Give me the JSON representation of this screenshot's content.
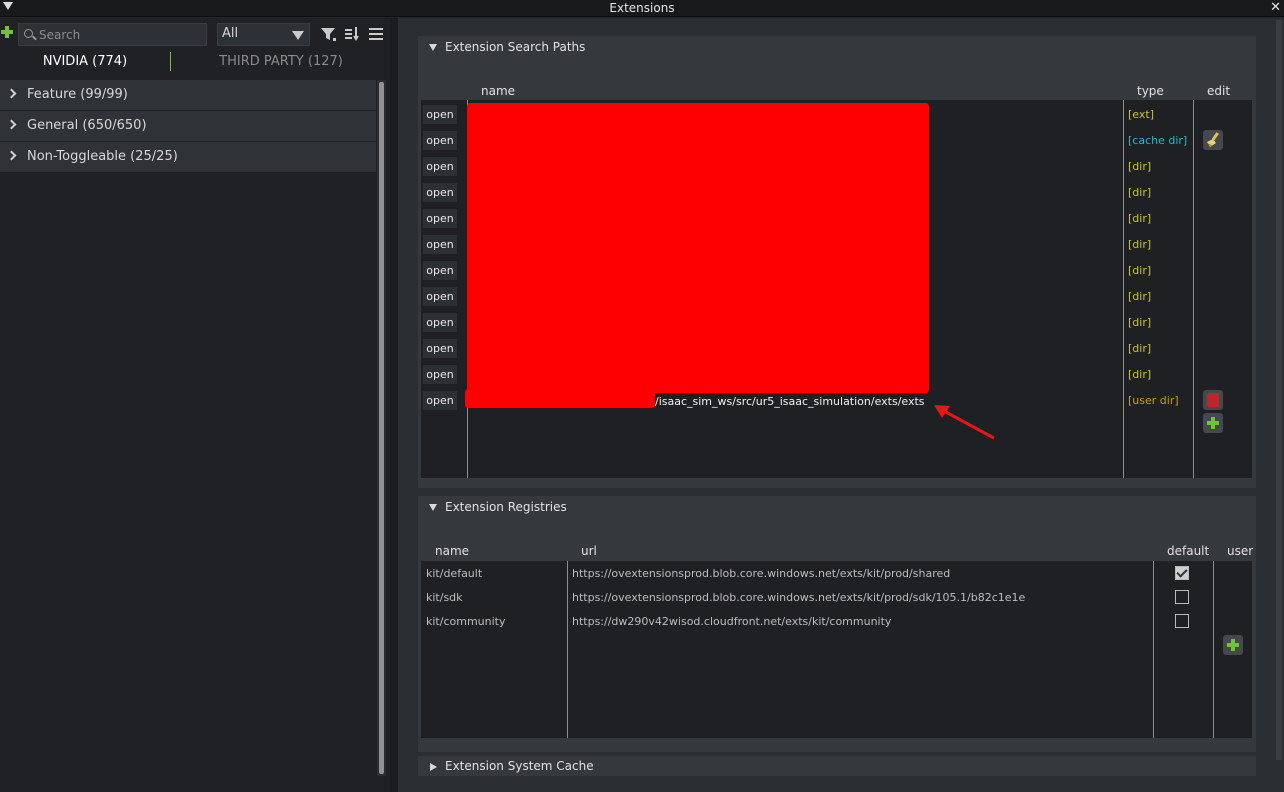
{
  "window": {
    "title": "Extensions",
    "close": "✕"
  },
  "toolbar": {
    "search_placeholder": "Search",
    "filter_value": "All"
  },
  "tabs": [
    {
      "label": "NVIDIA (774)"
    },
    {
      "label": "THIRD PARTY (127)"
    }
  ],
  "categories": [
    {
      "label": "Feature (99/99)"
    },
    {
      "label": "General (650/650)"
    },
    {
      "label": "Non-Toggleable (25/25)"
    }
  ],
  "search_paths": {
    "header": "Extension Search Paths",
    "columns": {
      "name": "name",
      "type": "type",
      "edit": "edit"
    },
    "open_label": "open",
    "rows": [
      {
        "type": "[ext]"
      },
      {
        "type": "[cache dir]"
      },
      {
        "type": "[dir]"
      },
      {
        "type": "[dir]"
      },
      {
        "type": "[dir]"
      },
      {
        "type": "[dir]"
      },
      {
        "type": "[dir]"
      },
      {
        "type": "[dir]"
      },
      {
        "type": "[dir]"
      },
      {
        "type": "[dir]"
      },
      {
        "type": "[dir]"
      },
      {
        "type": "[user dir]",
        "path_visible": "/isaac_sim_ws/src/ur5_isaac_simulation/exts/exts"
      }
    ]
  },
  "registries": {
    "header": "Extension Registries",
    "columns": {
      "name": "name",
      "url": "url",
      "default": "default",
      "user": "user"
    },
    "rows": [
      {
        "name": "kit/default",
        "url": "https://ovextensionsprod.blob.core.windows.net/exts/kit/prod/shared",
        "default": true
      },
      {
        "name": "kit/sdk",
        "url": "https://ovextensionsprod.blob.core.windows.net/exts/kit/prod/sdk/105.1/b82c1e1e",
        "default": false
      },
      {
        "name": "kit/community",
        "url": "https://dw290v42wisod.cloudfront.net/exts/kit/community",
        "default": false
      }
    ]
  },
  "system_cache": {
    "header": "Extension System Cache"
  },
  "colors": {
    "accent_green": "#6fc23a",
    "type_dir": "#c9c23a",
    "type_cache": "#2fb3c7",
    "type_user": "#c99b20",
    "redaction": "#ff0000",
    "annotation_arrow": "#e01818"
  }
}
